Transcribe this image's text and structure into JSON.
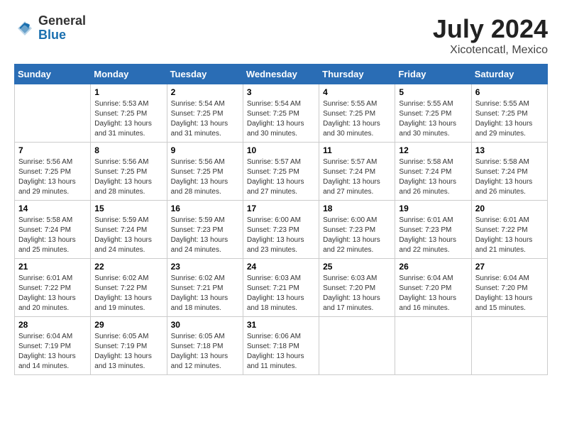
{
  "logo": {
    "general": "General",
    "blue": "Blue"
  },
  "title": "July 2024",
  "subtitle": "Xicotencatl, Mexico",
  "headers": [
    "Sunday",
    "Monday",
    "Tuesday",
    "Wednesday",
    "Thursday",
    "Friday",
    "Saturday"
  ],
  "weeks": [
    [
      {
        "day": "",
        "sunrise": "",
        "sunset": "",
        "daylight": ""
      },
      {
        "day": "1",
        "sunrise": "Sunrise: 5:53 AM",
        "sunset": "Sunset: 7:25 PM",
        "daylight": "Daylight: 13 hours and 31 minutes."
      },
      {
        "day": "2",
        "sunrise": "Sunrise: 5:54 AM",
        "sunset": "Sunset: 7:25 PM",
        "daylight": "Daylight: 13 hours and 31 minutes."
      },
      {
        "day": "3",
        "sunrise": "Sunrise: 5:54 AM",
        "sunset": "Sunset: 7:25 PM",
        "daylight": "Daylight: 13 hours and 30 minutes."
      },
      {
        "day": "4",
        "sunrise": "Sunrise: 5:55 AM",
        "sunset": "Sunset: 7:25 PM",
        "daylight": "Daylight: 13 hours and 30 minutes."
      },
      {
        "day": "5",
        "sunrise": "Sunrise: 5:55 AM",
        "sunset": "Sunset: 7:25 PM",
        "daylight": "Daylight: 13 hours and 30 minutes."
      },
      {
        "day": "6",
        "sunrise": "Sunrise: 5:55 AM",
        "sunset": "Sunset: 7:25 PM",
        "daylight": "Daylight: 13 hours and 29 minutes."
      }
    ],
    [
      {
        "day": "7",
        "sunrise": "Sunrise: 5:56 AM",
        "sunset": "Sunset: 7:25 PM",
        "daylight": "Daylight: 13 hours and 29 minutes."
      },
      {
        "day": "8",
        "sunrise": "Sunrise: 5:56 AM",
        "sunset": "Sunset: 7:25 PM",
        "daylight": "Daylight: 13 hours and 28 minutes."
      },
      {
        "day": "9",
        "sunrise": "Sunrise: 5:56 AM",
        "sunset": "Sunset: 7:25 PM",
        "daylight": "Daylight: 13 hours and 28 minutes."
      },
      {
        "day": "10",
        "sunrise": "Sunrise: 5:57 AM",
        "sunset": "Sunset: 7:25 PM",
        "daylight": "Daylight: 13 hours and 27 minutes."
      },
      {
        "day": "11",
        "sunrise": "Sunrise: 5:57 AM",
        "sunset": "Sunset: 7:24 PM",
        "daylight": "Daylight: 13 hours and 27 minutes."
      },
      {
        "day": "12",
        "sunrise": "Sunrise: 5:58 AM",
        "sunset": "Sunset: 7:24 PM",
        "daylight": "Daylight: 13 hours and 26 minutes."
      },
      {
        "day": "13",
        "sunrise": "Sunrise: 5:58 AM",
        "sunset": "Sunset: 7:24 PM",
        "daylight": "Daylight: 13 hours and 26 minutes."
      }
    ],
    [
      {
        "day": "14",
        "sunrise": "Sunrise: 5:58 AM",
        "sunset": "Sunset: 7:24 PM",
        "daylight": "Daylight: 13 hours and 25 minutes."
      },
      {
        "day": "15",
        "sunrise": "Sunrise: 5:59 AM",
        "sunset": "Sunset: 7:24 PM",
        "daylight": "Daylight: 13 hours and 24 minutes."
      },
      {
        "day": "16",
        "sunrise": "Sunrise: 5:59 AM",
        "sunset": "Sunset: 7:23 PM",
        "daylight": "Daylight: 13 hours and 24 minutes."
      },
      {
        "day": "17",
        "sunrise": "Sunrise: 6:00 AM",
        "sunset": "Sunset: 7:23 PM",
        "daylight": "Daylight: 13 hours and 23 minutes."
      },
      {
        "day": "18",
        "sunrise": "Sunrise: 6:00 AM",
        "sunset": "Sunset: 7:23 PM",
        "daylight": "Daylight: 13 hours and 22 minutes."
      },
      {
        "day": "19",
        "sunrise": "Sunrise: 6:01 AM",
        "sunset": "Sunset: 7:23 PM",
        "daylight": "Daylight: 13 hours and 22 minutes."
      },
      {
        "day": "20",
        "sunrise": "Sunrise: 6:01 AM",
        "sunset": "Sunset: 7:22 PM",
        "daylight": "Daylight: 13 hours and 21 minutes."
      }
    ],
    [
      {
        "day": "21",
        "sunrise": "Sunrise: 6:01 AM",
        "sunset": "Sunset: 7:22 PM",
        "daylight": "Daylight: 13 hours and 20 minutes."
      },
      {
        "day": "22",
        "sunrise": "Sunrise: 6:02 AM",
        "sunset": "Sunset: 7:22 PM",
        "daylight": "Daylight: 13 hours and 19 minutes."
      },
      {
        "day": "23",
        "sunrise": "Sunrise: 6:02 AM",
        "sunset": "Sunset: 7:21 PM",
        "daylight": "Daylight: 13 hours and 18 minutes."
      },
      {
        "day": "24",
        "sunrise": "Sunrise: 6:03 AM",
        "sunset": "Sunset: 7:21 PM",
        "daylight": "Daylight: 13 hours and 18 minutes."
      },
      {
        "day": "25",
        "sunrise": "Sunrise: 6:03 AM",
        "sunset": "Sunset: 7:20 PM",
        "daylight": "Daylight: 13 hours and 17 minutes."
      },
      {
        "day": "26",
        "sunrise": "Sunrise: 6:04 AM",
        "sunset": "Sunset: 7:20 PM",
        "daylight": "Daylight: 13 hours and 16 minutes."
      },
      {
        "day": "27",
        "sunrise": "Sunrise: 6:04 AM",
        "sunset": "Sunset: 7:20 PM",
        "daylight": "Daylight: 13 hours and 15 minutes."
      }
    ],
    [
      {
        "day": "28",
        "sunrise": "Sunrise: 6:04 AM",
        "sunset": "Sunset: 7:19 PM",
        "daylight": "Daylight: 13 hours and 14 minutes."
      },
      {
        "day": "29",
        "sunrise": "Sunrise: 6:05 AM",
        "sunset": "Sunset: 7:19 PM",
        "daylight": "Daylight: 13 hours and 13 minutes."
      },
      {
        "day": "30",
        "sunrise": "Sunrise: 6:05 AM",
        "sunset": "Sunset: 7:18 PM",
        "daylight": "Daylight: 13 hours and 12 minutes."
      },
      {
        "day": "31",
        "sunrise": "Sunrise: 6:06 AM",
        "sunset": "Sunset: 7:18 PM",
        "daylight": "Daylight: 13 hours and 11 minutes."
      },
      {
        "day": "",
        "sunrise": "",
        "sunset": "",
        "daylight": ""
      },
      {
        "day": "",
        "sunrise": "",
        "sunset": "",
        "daylight": ""
      },
      {
        "day": "",
        "sunrise": "",
        "sunset": "",
        "daylight": ""
      }
    ]
  ]
}
